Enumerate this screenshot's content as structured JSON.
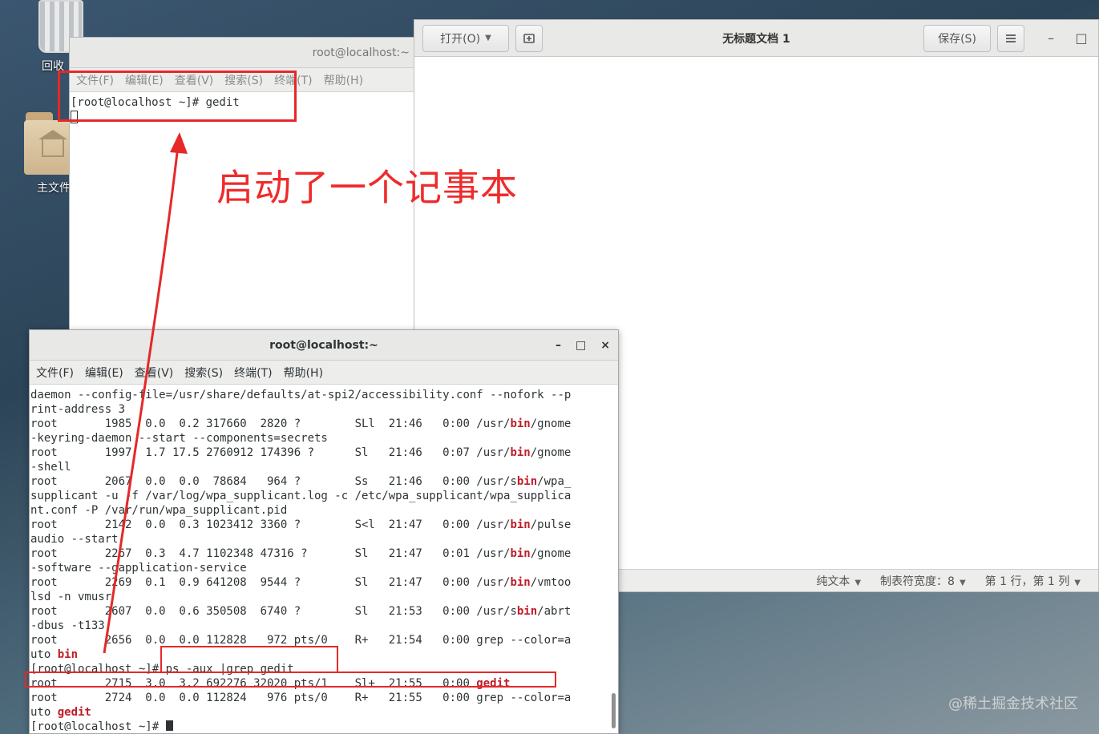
{
  "desktop": {
    "trash_label": "回收",
    "home_label": "主文件"
  },
  "term_top": {
    "title": "root@localhost:~",
    "menu": [
      "文件(F)",
      "编辑(E)",
      "查看(V)",
      "搜索(S)",
      "终端(T)",
      "帮助(H)"
    ],
    "prompt_line": "[root@localhost ~]# gedit"
  },
  "gedit": {
    "open_label": "打开(O)",
    "title": "无标题文档 1",
    "save_label": "保存(S)",
    "menu_icon": "hamburger-icon",
    "minimize": "–",
    "maximize": "□",
    "status": {
      "syntax": "纯文本",
      "tab_width": "制表符宽度：8",
      "position": "第 1 行，第 1 列"
    }
  },
  "term_bottom": {
    "title": "root@localhost:~",
    "controls": [
      "–",
      "□",
      "×"
    ],
    "menu": [
      "文件(F)",
      "编辑(E)",
      "查看(V)",
      "搜索(S)",
      "终端(T)",
      "帮助(H)"
    ],
    "lines": [
      [
        "daemon --config-file=/usr/share/defaults/at-spi2/accessibility.conf --nofork --p"
      ],
      [
        "rint-address 3"
      ],
      [
        "root       1985  0.0  0.2 317660  2820 ?        SLl  21:46   0:00 /usr/",
        {
          "b": "bin"
        },
        "/gnome"
      ],
      [
        "-keyring-daemon --start --components=secrets"
      ],
      [
        "root       1997  1.7 17.5 2760912 174396 ?      Sl   21:46   0:07 /usr/",
        {
          "b": "bin"
        },
        "/gnome"
      ],
      [
        "-shell"
      ],
      [
        "root       2067  0.0  0.0  78684   964 ?        Ss   21:46   0:00 /usr/s",
        {
          "b": "bin"
        },
        "/wpa_"
      ],
      [
        "supplicant -u -f /var/log/wpa_supplicant.log -c /etc/wpa_supplicant/wpa_supplica"
      ],
      [
        "nt.conf -P /var/run/wpa_supplicant.pid"
      ],
      [
        "root       2142  0.0  0.3 1023412 3360 ?        S<l  21:47   0:00 /usr/",
        {
          "b": "bin"
        },
        "/pulse"
      ],
      [
        "audio --start"
      ],
      [
        "root       2267  0.3  4.7 1102348 47316 ?       Sl   21:47   0:01 /usr/",
        {
          "b": "bin"
        },
        "/gnome"
      ],
      [
        "-software --gapplication-service"
      ],
      [
        "root       2269  0.1  0.9 641208  9544 ?        Sl   21:47   0:00 /usr/",
        {
          "b": "bin"
        },
        "/vmtoo"
      ],
      [
        "lsd -n vmusr"
      ],
      [
        "root       2607  0.0  0.6 350508  6740 ?        Sl   21:53   0:00 /usr/s",
        {
          "b": "bin"
        },
        "/abrt"
      ],
      [
        "-dbus -t133"
      ],
      [
        "root       2656  0.0  0.0 112828   972 pts/0    R+   21:54   0:00 grep --color=a"
      ],
      [
        "uto ",
        {
          "b": "bin"
        }
      ],
      [
        "[root@localhost ~]# ps -aux |grep gedit"
      ],
      [
        "root       2715  3.0  3.2 692276 32020 pts/1    Sl+  21:55   0:00 ",
        {
          "b": "gedit"
        }
      ],
      [
        "root       2724  0.0  0.0 112824   976 pts/0    R+   21:55   0:00 grep --color=a"
      ],
      [
        "uto ",
        {
          "b": "gedit"
        }
      ],
      [
        "[root@localhost ~]# ",
        {
          "cursor": true
        }
      ]
    ]
  },
  "annotation": {
    "text": "启动了一个记事本",
    "color": "#e62828"
  },
  "watermark": "@稀土掘金技术社区"
}
